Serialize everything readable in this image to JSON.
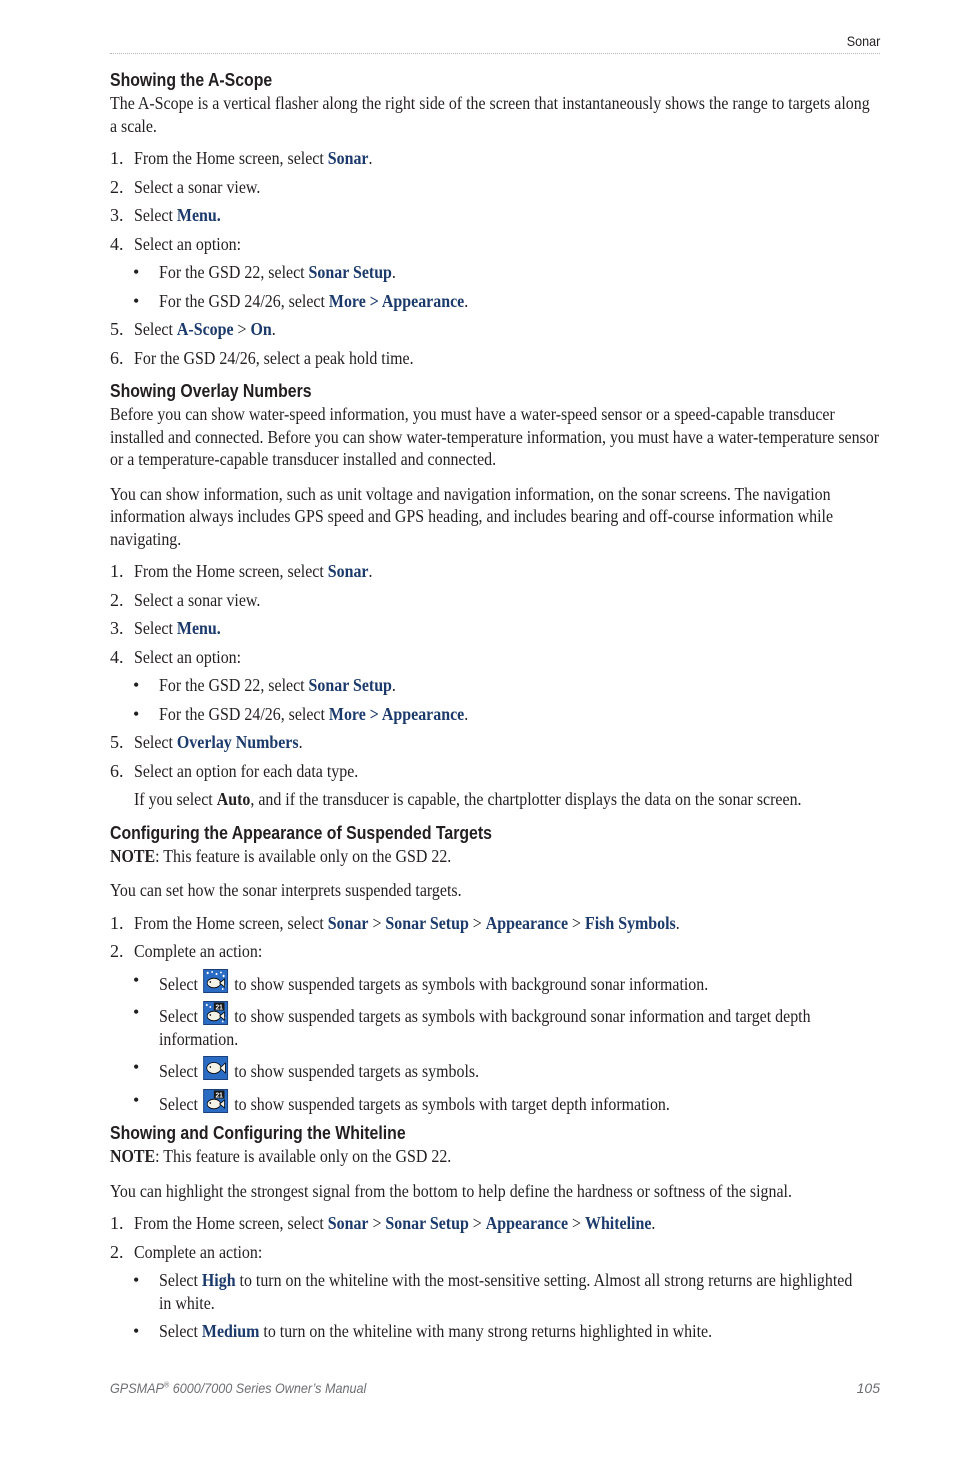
{
  "header": {
    "section": "Sonar"
  },
  "sections": {
    "ascope": {
      "title": "Showing the A-Scope",
      "intro": "The A-Scope is a vertical flasher along the right side of the screen that instantaneously shows the range to targets along a scale.",
      "steps": {
        "s1_num": "1.",
        "s1_text": "From the Home screen, select ",
        "s1_kw": "Sonar",
        "s1_end": ".",
        "s2_num": "2.",
        "s2_text": "Select a sonar view.",
        "s3_num": "3.",
        "s3_text": "Select ",
        "s3_kw": "Menu.",
        "s4_num": "4.",
        "s4_text": "Select an option:",
        "b1_text": "For the GSD 22, select ",
        "b1_kw": "Sonar Setup",
        "b1_end": ".",
        "b2_text": "For the GSD 24/26, select ",
        "b2_kw": "More > Appearance",
        "b2_end": ".",
        "s5_num": "5.",
        "s5_text": "Select ",
        "s5_kw1": "A-Scope",
        "s5_sep": " > ",
        "s5_kw2": "On",
        "s5_end": ".",
        "s6_num": "6.",
        "s6_text": "For the GSD 24/26, select a peak hold time."
      }
    },
    "overlay": {
      "title": "Showing Overlay Numbers",
      "intro1": "Before you can show water-speed information, you must have a water-speed sensor or a speed-capable transducer installed and connected. Before you can show water-temperature information, you must have a water-temperature sensor or a temperature-capable transducer installed and connected.",
      "intro2": "You can show information, such as unit voltage and navigation information, on the sonar screens. The navigation information always includes GPS speed and GPS heading, and includes bearing and off-course information while navigating.",
      "steps": {
        "s1_num": "1.",
        "s1_text": "From the Home screen, select ",
        "s1_kw": "Sonar",
        "s1_end": ".",
        "s2_num": "2.",
        "s2_text": "Select a sonar view.",
        "s3_num": "3.",
        "s3_text": "Select ",
        "s3_kw": "Menu.",
        "s4_num": "4.",
        "s4_text": "Select an option:",
        "b1_text": "For the GSD 22, select ",
        "b1_kw": "Sonar Setup",
        "b1_end": ".",
        "b2_text": "For the GSD 24/26, select ",
        "b2_kw": "More > Appearance",
        "b2_end": ".",
        "s5_num": "5.",
        "s5_text": "Select ",
        "s5_kw": "Overlay Numbers",
        "s5_end": ".",
        "s6_num": "6.",
        "s6_text": "Select an option for each data type.",
        "note_pre": "If you select ",
        "note_kw": "Auto",
        "note_post": ", and if the transducer is capable, the chartplotter displays the data on the sonar screen."
      }
    },
    "suspended": {
      "title": "Configuring the Appearance of Suspended Targets",
      "note_label": "NOTE",
      "note_text": ": This feature is available only on the GSD 22.",
      "intro": "You can set how the sonar interprets suspended targets.",
      "steps": {
        "s1_num": "1.",
        "s1_text": "From the Home screen, select ",
        "s1_kw1": "Sonar",
        "s1_kw2": "Sonar Setup",
        "s1_kw3": "Appearance",
        "s1_kw4": "Fish Symbols",
        "sep": " > ",
        "s1_end": ".",
        "s2_num": "2.",
        "s2_text": "Complete an action:",
        "select": "Select ",
        "b1_text": " to show suspended targets as symbols with background sonar information.",
        "b2_text": " to show suspended targets as symbols with background sonar information and target depth information.",
        "b3_text": " to show suspended targets as symbols.",
        "b4_text": " to show suspended targets as symbols with target depth information.",
        "icons": [
          "fish-with-background-icon",
          "fish-with-background-and-depth-icon",
          "fish-icon",
          "fish-with-depth-icon"
        ],
        "depth_badge": "21"
      }
    },
    "whiteline": {
      "title": "Showing and Configuring the Whiteline",
      "note_label": "NOTE",
      "note_text": ": This feature is available only on the GSD 22.",
      "intro": "You can highlight the strongest signal from the bottom to help define the hardness or softness of the signal.",
      "steps": {
        "s1_num": "1.",
        "s1_text": "From the Home screen, select ",
        "s1_kw1": "Sonar",
        "s1_kw2": "Sonar Setup",
        "s1_kw3": "Appearance",
        "s1_kw4": "Whiteline",
        "sep": " > ",
        "s1_end": ".",
        "s2_num": "2.",
        "s2_text": "Complete an action:",
        "select": "Select ",
        "b1_kw": "High",
        "b1_text": " to turn on the whiteline with the most-sensitive setting. Almost all strong returns are highlighted in white.",
        "b2_kw": "Medium",
        "b2_text": " to turn on the whiteline with many strong returns highlighted in white."
      }
    }
  },
  "footer": {
    "manual_brand": "GPSMAP",
    "manual_reg": "®",
    "manual_rest": " 6000/7000 Series Owner’s Manual",
    "page_number": "105"
  },
  "colors": {
    "keyword": "#1b3a6b",
    "icon_bg": "#2a6bc4"
  }
}
